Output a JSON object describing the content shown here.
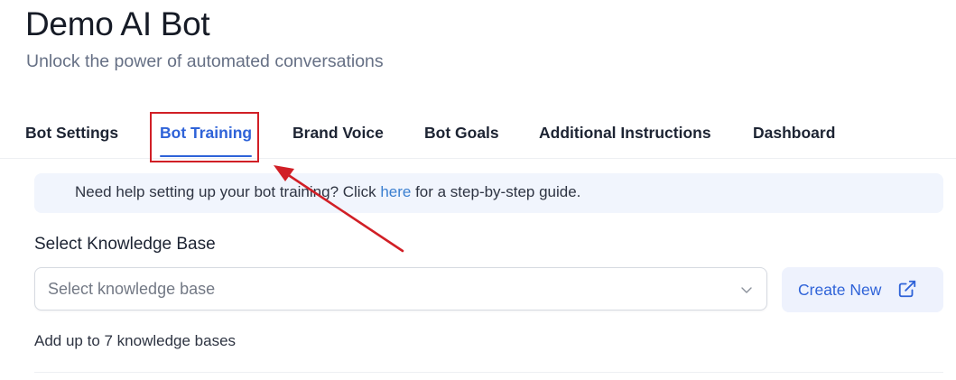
{
  "header": {
    "title": "Demo AI Bot",
    "subtitle": "Unlock the power of automated conversations"
  },
  "tabs": [
    {
      "label": "Bot Settings",
      "active": false
    },
    {
      "label": "Bot Training",
      "active": true
    },
    {
      "label": "Brand Voice",
      "active": false
    },
    {
      "label": "Bot Goals",
      "active": false
    },
    {
      "label": "Additional Instructions",
      "active": false
    },
    {
      "label": "Dashboard",
      "active": false
    }
  ],
  "help_banner": {
    "text_before": "Need help setting up your bot training? Click ",
    "link_text": "here",
    "text_after": " for a step-by-step guide."
  },
  "knowledge_base": {
    "label": "Select Knowledge Base",
    "placeholder": "Select knowledge base",
    "dropdown_icon": "chevron-down-icon",
    "create_button_label": "Create New",
    "create_button_icon": "external-link-icon",
    "hint": "Add up to 7 knowledge bases"
  },
  "colors": {
    "accent": "#2f63d8",
    "link": "#3b7fd0",
    "banner_background": "#f1f5fd",
    "button_background": "#eef2fd",
    "annotation_red": "#d11f26"
  }
}
